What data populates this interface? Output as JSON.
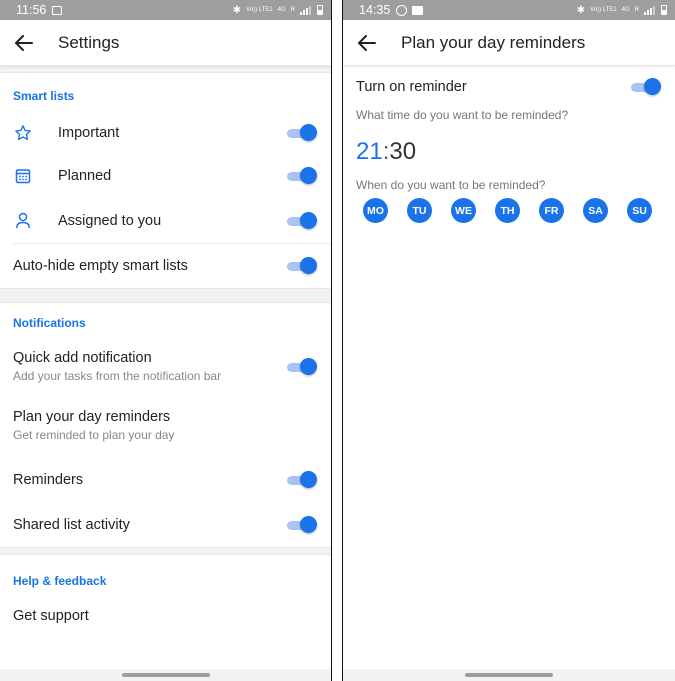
{
  "left": {
    "status": {
      "time": "11:56",
      "net_top": "Vo)) LTE1",
      "net_mid": "4G",
      "net_bot": "R"
    },
    "title": "Settings",
    "smart_lists": {
      "header": "Smart lists",
      "items": [
        {
          "label": "Important",
          "icon": "star-icon",
          "on": true
        },
        {
          "label": "Planned",
          "icon": "calendar-icon",
          "on": true
        },
        {
          "label": "Assigned to you",
          "icon": "person-icon",
          "on": true
        }
      ],
      "auto_hide": {
        "label": "Auto-hide empty smart lists",
        "on": true
      }
    },
    "notifications": {
      "header": "Notifications",
      "quick_add": {
        "label": "Quick add notification",
        "sub": "Add your tasks from the notification bar",
        "on": true
      },
      "plan_day": {
        "label": "Plan your day reminders",
        "sub": "Get reminded to plan your day"
      },
      "reminders": {
        "label": "Reminders",
        "on": true
      },
      "shared": {
        "label": "Shared list activity",
        "on": true
      }
    },
    "help": {
      "header": "Help & feedback",
      "support": "Get support"
    }
  },
  "right": {
    "status": {
      "time": "14:35",
      "net_top": "Vo)) LTE1",
      "net_mid": "4G",
      "net_bot": "R"
    },
    "title": "Plan your day reminders",
    "turn_on": {
      "label": "Turn on reminder",
      "on": true
    },
    "time_question": "What time do you want to be reminded?",
    "time": {
      "hh": "21",
      "sep": ":",
      "mm": "30"
    },
    "days_question": "When do you want to be reminded?",
    "days": [
      "MO",
      "TU",
      "WE",
      "TH",
      "FR",
      "SA",
      "SU"
    ]
  },
  "colors": {
    "accent": "#1a73e8",
    "toggle_track": "#a9c4f3",
    "status_bar": "#9e9e9e"
  }
}
